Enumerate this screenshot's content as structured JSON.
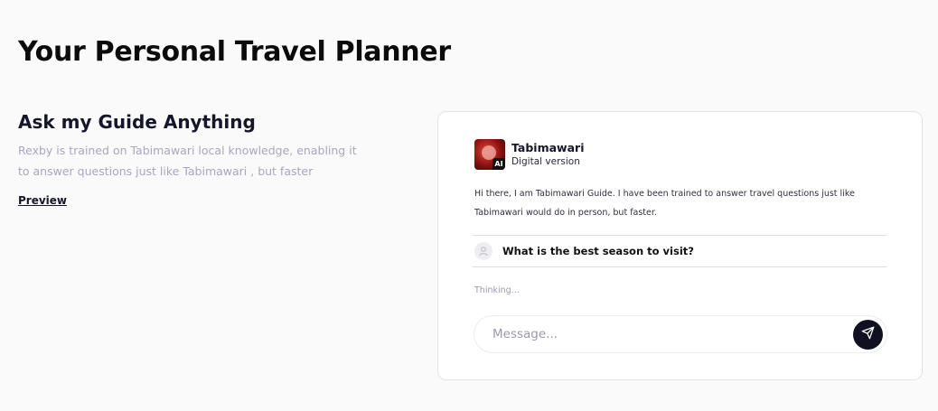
{
  "page": {
    "title": "Your Personal Travel Planner"
  },
  "intro_section": {
    "heading": "Ask my Guide Anything",
    "description": "Rexby is trained on Tabimawari local knowledge, enabling it to answer questions just like Tabimawari , but faster",
    "preview_link": "Preview"
  },
  "chat": {
    "guide_name": "Tabimawari",
    "guide_subtitle": "Digital version",
    "avatar_badge": "AI",
    "intro_message": "Hi there, I am Tabimawari Guide. I have been trained to answer travel questions just like Tabimawari would do in person, but faster.",
    "user_question": "What is the best season to visit?",
    "status": "Thinking...",
    "input_placeholder": "Message...",
    "send_icon": "send-icon"
  },
  "colors": {
    "background": "#fafafa",
    "muted_text": "#a7a7bd",
    "send_button": "#0f1020",
    "card_border": "#e3e3e8"
  }
}
